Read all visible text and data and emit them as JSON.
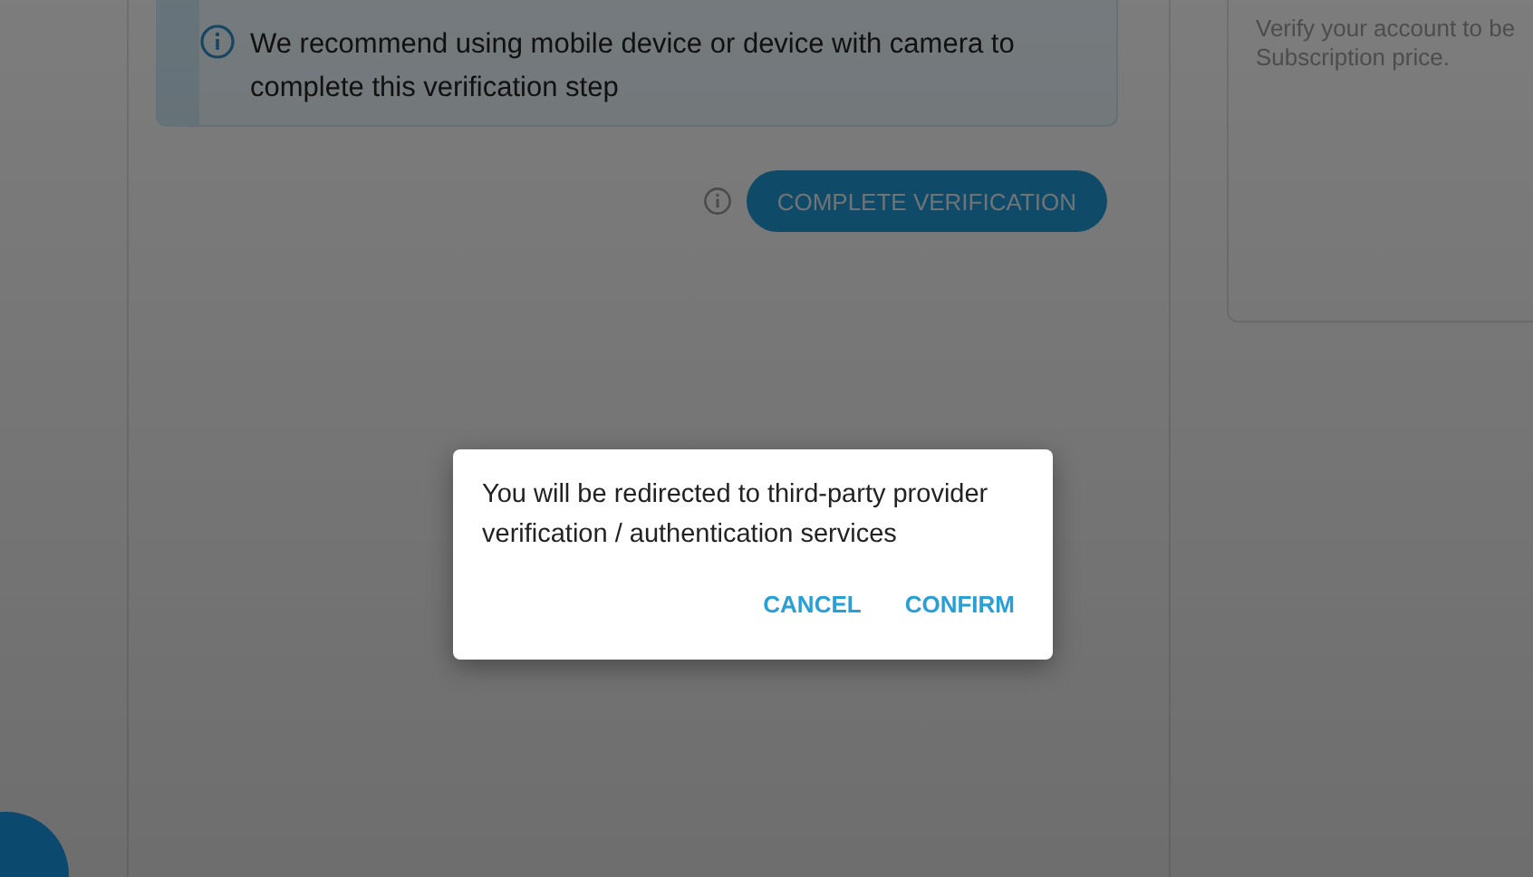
{
  "alert": {
    "text": "We recommend using mobile device or device with camera to complete this verification step"
  },
  "action": {
    "label": "COMPLETE VERIFICATION"
  },
  "side_card": {
    "lines": [
      "Verify your account to be",
      "Subscription price."
    ]
  },
  "dialog": {
    "message": "You will be redirected to third-party provider verification / authentication services",
    "buttons": [
      "CANCEL",
      "CONFIRM"
    ]
  }
}
